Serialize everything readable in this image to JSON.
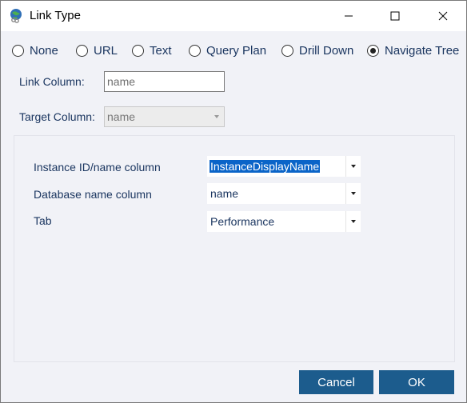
{
  "window": {
    "title": "Link Type"
  },
  "link_types": [
    {
      "label": "None",
      "checked": false
    },
    {
      "label": "URL",
      "checked": false
    },
    {
      "label": "Text",
      "checked": false
    },
    {
      "label": "Query Plan",
      "checked": false
    },
    {
      "label": "Drill Down",
      "checked": false
    },
    {
      "label": "Navigate Tree",
      "checked": true
    }
  ],
  "link_column": {
    "label": "Link Column:",
    "value": "name"
  },
  "target_column": {
    "label": "Target Column:",
    "value": "name"
  },
  "mapping": {
    "instance": {
      "label": "Instance ID/name column",
      "value": "InstanceDisplayName"
    },
    "database": {
      "label": "Database name column",
      "value": "name"
    },
    "tab": {
      "label": "Tab",
      "value": "Performance"
    }
  },
  "buttons": {
    "cancel": "Cancel",
    "ok": "OK"
  },
  "colors": {
    "accent": "#1c5c8d",
    "selection": "#0a64c8",
    "label_text": "#1b3660"
  },
  "icons": [
    "app-icon",
    "minimize-icon",
    "maximize-icon",
    "close-icon",
    "dropdown-arrow-icon"
  ]
}
